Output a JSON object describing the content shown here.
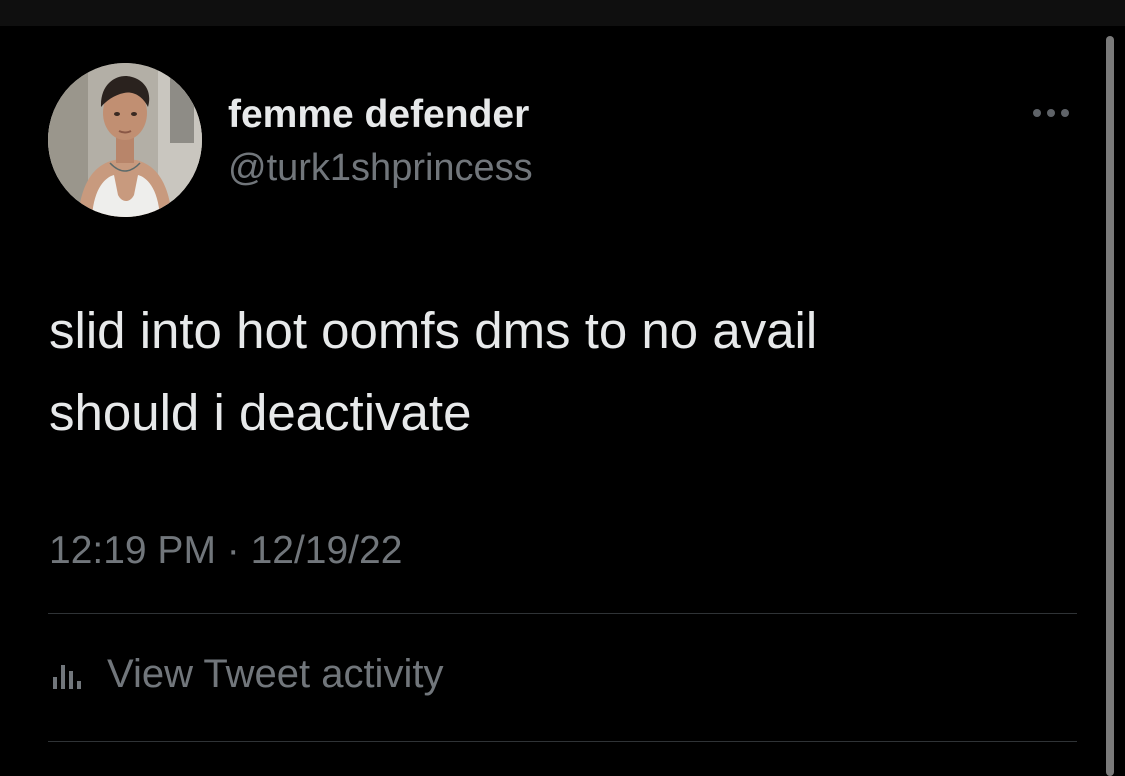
{
  "tweet": {
    "author": {
      "display_name": "femme defender",
      "handle": "@turk1shprincess",
      "avatar_icon": "profile-photo"
    },
    "text_lines": [
      "slid into hot oomfs dms to no avail",
      "should i deactivate"
    ],
    "timestamp": "12:19 PM · 12/19/22",
    "more_icon": "more-horizontal-icon",
    "activity": {
      "icon": "bar-chart-icon",
      "label": "View Tweet activity"
    }
  },
  "colors": {
    "background": "#000000",
    "primary_text": "#e7e9ea",
    "secondary_text": "#71767b",
    "divider": "#2f3336"
  }
}
